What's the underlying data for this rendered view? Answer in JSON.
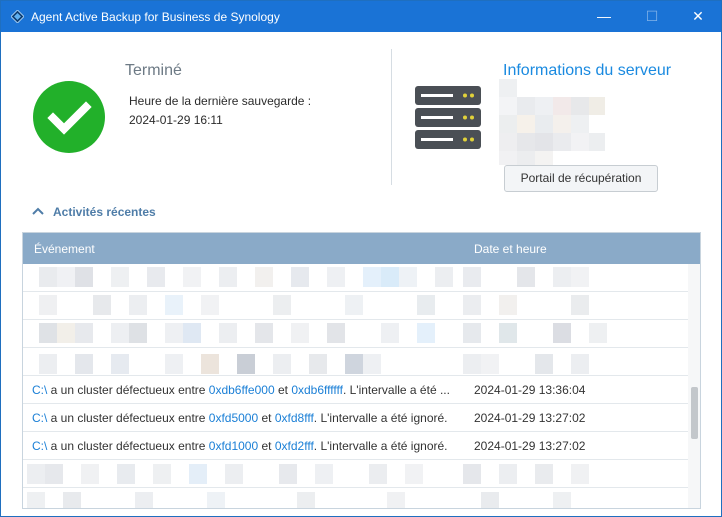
{
  "window": {
    "title": "Agent Active Backup for Business de Synology",
    "controls": {
      "minimize": "—",
      "maximize": "☐",
      "close": "✕"
    }
  },
  "status": {
    "title": "Terminé",
    "last_backup_label": "Heure de la dernière sauvegarde :",
    "last_backup_value": "2024-01-29 16:11",
    "color": "#22b02a"
  },
  "server": {
    "title": "Informations du serveur",
    "portal_button": "Portail de récupération"
  },
  "activities": {
    "label": "Activités récentes",
    "columns": {
      "event": "Événement",
      "date": "Date et heure"
    },
    "rows": [
      {
        "drive": "C:\\",
        "t1": " a un cluster défectueux entre ",
        "a1": "0xdb6ffe000",
        "t2": " et ",
        "a2": "0xdb6ffffff",
        "t3": ". L'intervalle a été ...",
        "date": "2024-01-29 13:36:04"
      },
      {
        "drive": "C:\\",
        "t1": " a un cluster défectueux entre ",
        "a1": "0xfd5000",
        "t2": " et ",
        "a2": "0xfd8fff",
        "t3": ". L'intervalle a été ignoré.",
        "date": "2024-01-29 13:27:02"
      },
      {
        "drive": "C:\\",
        "t1": " a un cluster défectueux entre ",
        "a1": "0xfd1000",
        "t2": " et ",
        "a2": "0xfd2fff",
        "t3": ". L'intervalle a été ignoré.",
        "date": "2024-01-29 13:27:02"
      }
    ]
  },
  "colors": {
    "titlebar": "#1a73d6",
    "accent": "#1a8ae0",
    "table_header": "#8aaac8",
    "link": "#1a7fd6"
  }
}
